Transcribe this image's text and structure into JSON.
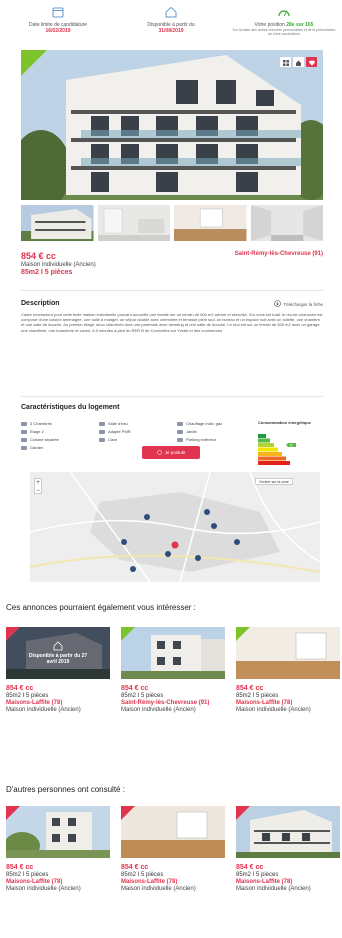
{
  "top_info": [
    {
      "title": "Date limite de candidature",
      "value": "16/02/2019",
      "sub": ""
    },
    {
      "title": "Disponible à partir du",
      "value": "31/08/2019",
      "sub": ""
    },
    {
      "title": "Votre position",
      "value": "28e sur 165",
      "sub": "Sur la base des autres données personnelles et de la présentation de votre candidature"
    }
  ],
  "listing": {
    "price": "854 € cc",
    "type": "Maison individuelle (Ancien)",
    "size": "85m2 I 5 pièces",
    "city": "Saint-Rémy-lès-Chevreuse (91)"
  },
  "description": {
    "title": "Description",
    "download": "Télécharger la fiche",
    "text": "Cadre enchanteur pour cette belle maison individuelle pouvant accueillir une famille sur un terrain de 600 m2 arboré et sécurisé. Sur vous est total, le rez-de-chaussée est composé d'une cuisine aménagée, une salle à manger, un séjour double avec cheminée et terrasse plein sud, un bureau et un espace nuit avec un toilette, une chambre et une salle de douche. Au premier étage, deux chambres dont une parentale avec dressing et une salle de douche. Le tout est sur un terrain de 600 m2 avec un garage, une chaufferie, une buanderie et caves. A 5 minutes à pied du RER B de Courcelles sur Yvette et des commerces."
  },
  "features": {
    "title": "Caractéristiques du logement",
    "items": [
      "3 Chambres",
      "Etage 2",
      "Cuisine séparée",
      "Garden",
      "Salle d'eau",
      "Adapté PMR",
      "Cave",
      "Chauffage indiv. gaz",
      "Jardin",
      "Parking extérieur"
    ],
    "energy_label": "Consommation énergétique",
    "energy_class": "C"
  },
  "cta": {
    "label": "Je postule"
  },
  "map": {
    "search_label": "Centrer sur la zone",
    "zoom_in": "+",
    "zoom_out": "−"
  },
  "section1": {
    "title": "Ces annonces pourraient également vous intéresser :",
    "cards": [
      {
        "price": "854 € cc",
        "size": "85m2 I 5 pièces",
        "city": "Maisons-Laffite (78)",
        "type": "Maison individuelle (Ancien)",
        "overlay": "Disponible à partir du 27 avril 2019"
      },
      {
        "price": "854 € cc",
        "size": "85m2 I 5 pièces",
        "city": "Saint-Rémy-lès-Chevreuse (91)",
        "type": "Maison individuelle (Ancien)",
        "overlay": ""
      },
      {
        "price": "854 € cc",
        "size": "85m2 I 5 pièces",
        "city": "Maisons-Laffite (78)",
        "type": "Maison individuelle (Ancien)",
        "overlay": ""
      }
    ]
  },
  "section2": {
    "title": "D'autres personnes ont consulté :",
    "cards": [
      {
        "price": "854 € cc",
        "size": "85m2 I 5 pièces",
        "city": "Maisons-Laffite (78)",
        "type": "Maison individuelle (Ancien)"
      },
      {
        "price": "854 € cc",
        "size": "85m2 I 5 pièces",
        "city": "Maisons-Laffite (78)",
        "type": "Maison individuelle (Ancien)"
      },
      {
        "price": "854 € cc",
        "size": "85m2 I 5 pièces",
        "city": "Maisons-Laffite (78)",
        "type": "Maison individuelle (Ancien)"
      }
    ]
  },
  "colors": {
    "accent": "#e0344f",
    "green": "#7dc32b",
    "blue": "#3a7bbf"
  },
  "icons": [
    "calendar-icon",
    "home-icon",
    "gauge-icon",
    "grid-icon",
    "share-icon",
    "heart-icon",
    "download-icon"
  ]
}
